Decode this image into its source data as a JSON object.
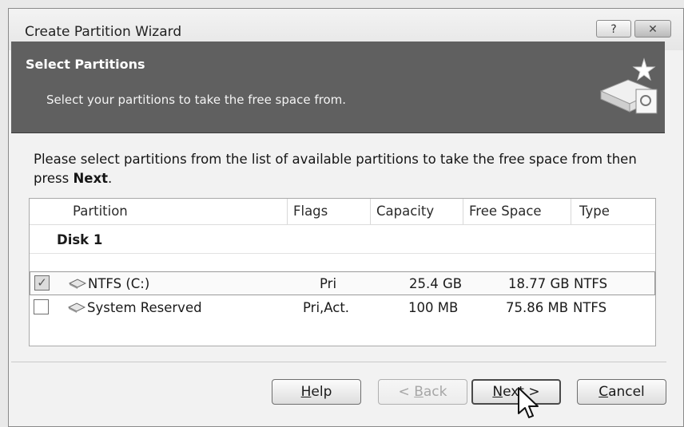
{
  "window": {
    "title": "Create Partition Wizard",
    "help_button": "?",
    "close_button": "✕"
  },
  "banner": {
    "title": "Select Partitions",
    "subtitle": "Select your partitions to take the free space from."
  },
  "instruction": {
    "text_before": "Please select partitions from the list of available partitions to take the free space from then press ",
    "bold": "Next",
    "text_after": "."
  },
  "table": {
    "columns": [
      "Partition",
      "Flags",
      "Capacity",
      "Free Space",
      "Type"
    ],
    "group": "Disk 1",
    "rows": [
      {
        "checked": true,
        "partition": "NTFS (C:)",
        "flags": "Pri",
        "capacity": "25.4 GB",
        "free_space": "18.77 GB",
        "type": "NTFS"
      },
      {
        "checked": false,
        "partition": "System Reserved",
        "flags": "Pri,Act.",
        "capacity": "100 MB",
        "free_space": "75.86 MB",
        "type": "NTFS"
      }
    ]
  },
  "buttons": {
    "help": {
      "underline": "H",
      "rest": "elp"
    },
    "back": {
      "prefix": "< ",
      "underline": "B",
      "rest": "ack"
    },
    "next": {
      "underline": "N",
      "rest": "ext >"
    },
    "cancel": {
      "underline": "C",
      "rest": "ancel"
    }
  },
  "checkmark": "✓"
}
